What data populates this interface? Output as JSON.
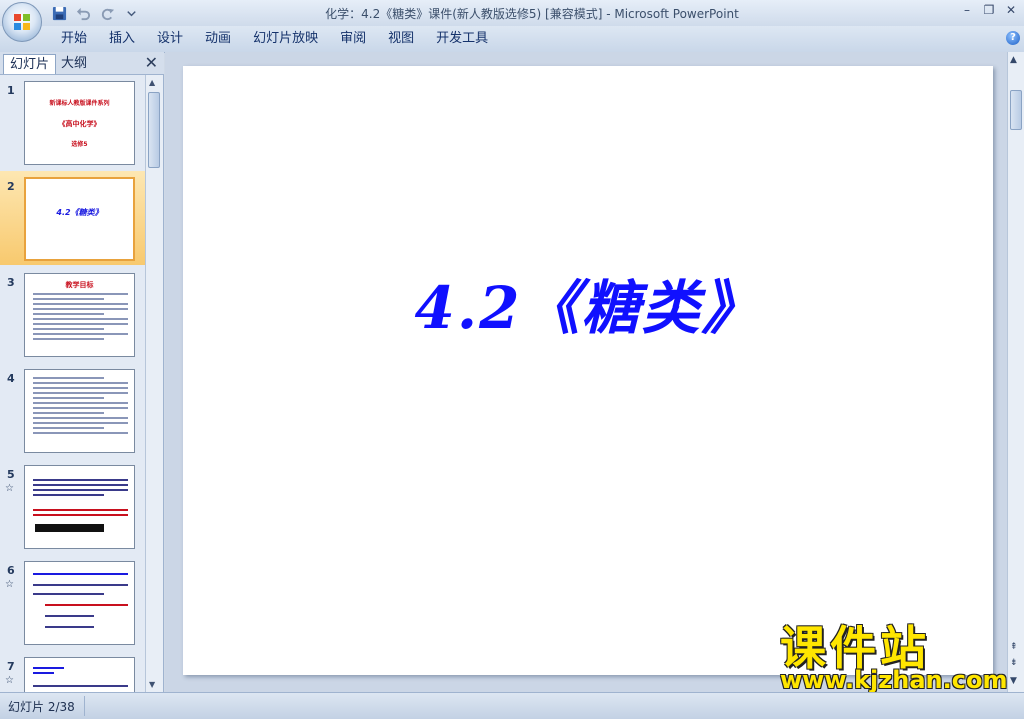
{
  "window": {
    "title": "化学：4.2《糖类》课件(新人教版选修5) [兼容模式] - Microsoft PowerPoint",
    "controls": [
      "–",
      "❐",
      "✕"
    ]
  },
  "ribbon": {
    "tabs": [
      "开始",
      "插入",
      "设计",
      "动画",
      "幻灯片放映",
      "审阅",
      "视图",
      "开发工具"
    ],
    "help": "?"
  },
  "pane": {
    "tab_slides": "幻灯片",
    "tab_outline": "大纲",
    "close": "✕",
    "thumbs": [
      {
        "num": "1",
        "lines": [
          "新课标人教版课件系列",
          "《高中化学》",
          "选修5"
        ]
      },
      {
        "num": "2",
        "lines": [
          "4.2《糖类》"
        ]
      },
      {
        "num": "3",
        "lines": [
          "教学目标"
        ]
      },
      {
        "num": "4",
        "lines": []
      },
      {
        "num": "5",
        "anim": "☆"
      },
      {
        "num": "6",
        "anim": "☆"
      },
      {
        "num": "7",
        "anim": "☆"
      }
    ]
  },
  "slide": {
    "title": "4.2《糖类》"
  },
  "watermark": {
    "cn": "课件站",
    "url": "www.kjzhan.com"
  },
  "status": {
    "slide_counter": "幻灯片 2/38"
  }
}
